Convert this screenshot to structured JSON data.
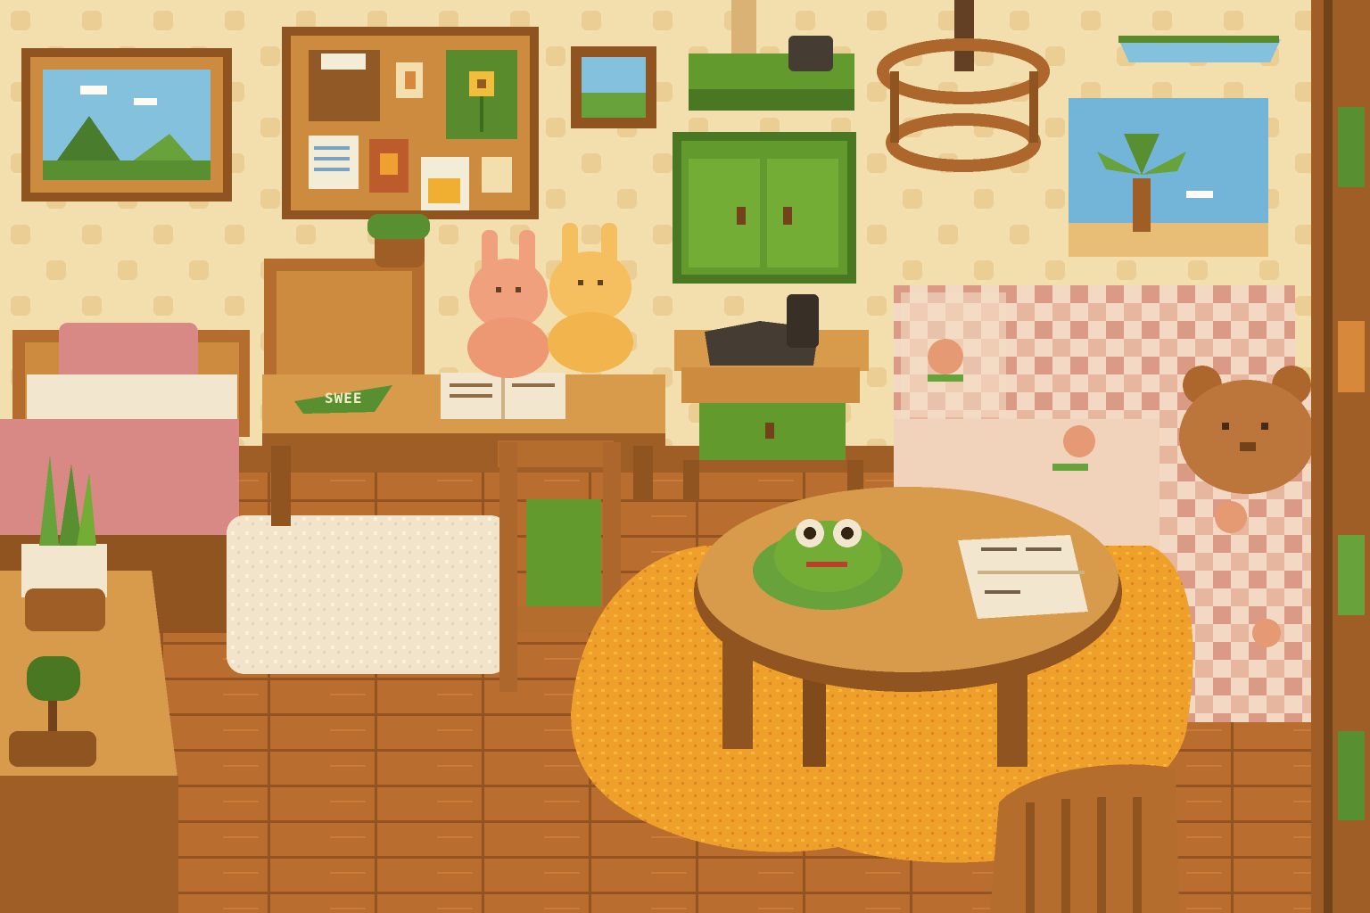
{
  "scene": {
    "type": "pixel-art cozy room interior",
    "palette": {
      "wall": "#f3e2b4",
      "wall_dots": "#e9cf95",
      "floor": "#b56a2e",
      "floor_dark": "#8e4f1f",
      "wood": "#c98a3e",
      "wood_dark": "#8a5424",
      "green": "#5a9a2c",
      "green_dark": "#3f7420",
      "rug_orange": "#f0a52a",
      "rug_white": "#f2ead8",
      "bed_pink": "#d6868a",
      "sofa_fabric": "#f1d6c4"
    }
  },
  "objects": {
    "desk_book_label": "SWEE",
    "landscape_painting": "mountain-landscape",
    "poster": "palm-tree-beach",
    "frog_plush": "frog-cushion",
    "bunny_plushes": [
      "pink-bunny",
      "yellow-bunny"
    ],
    "bear_plush": "bear-cushion",
    "telephone": "rotary-telephone",
    "cabinet": "green-wall-cabinet",
    "bulletin_board": "cork-board"
  }
}
